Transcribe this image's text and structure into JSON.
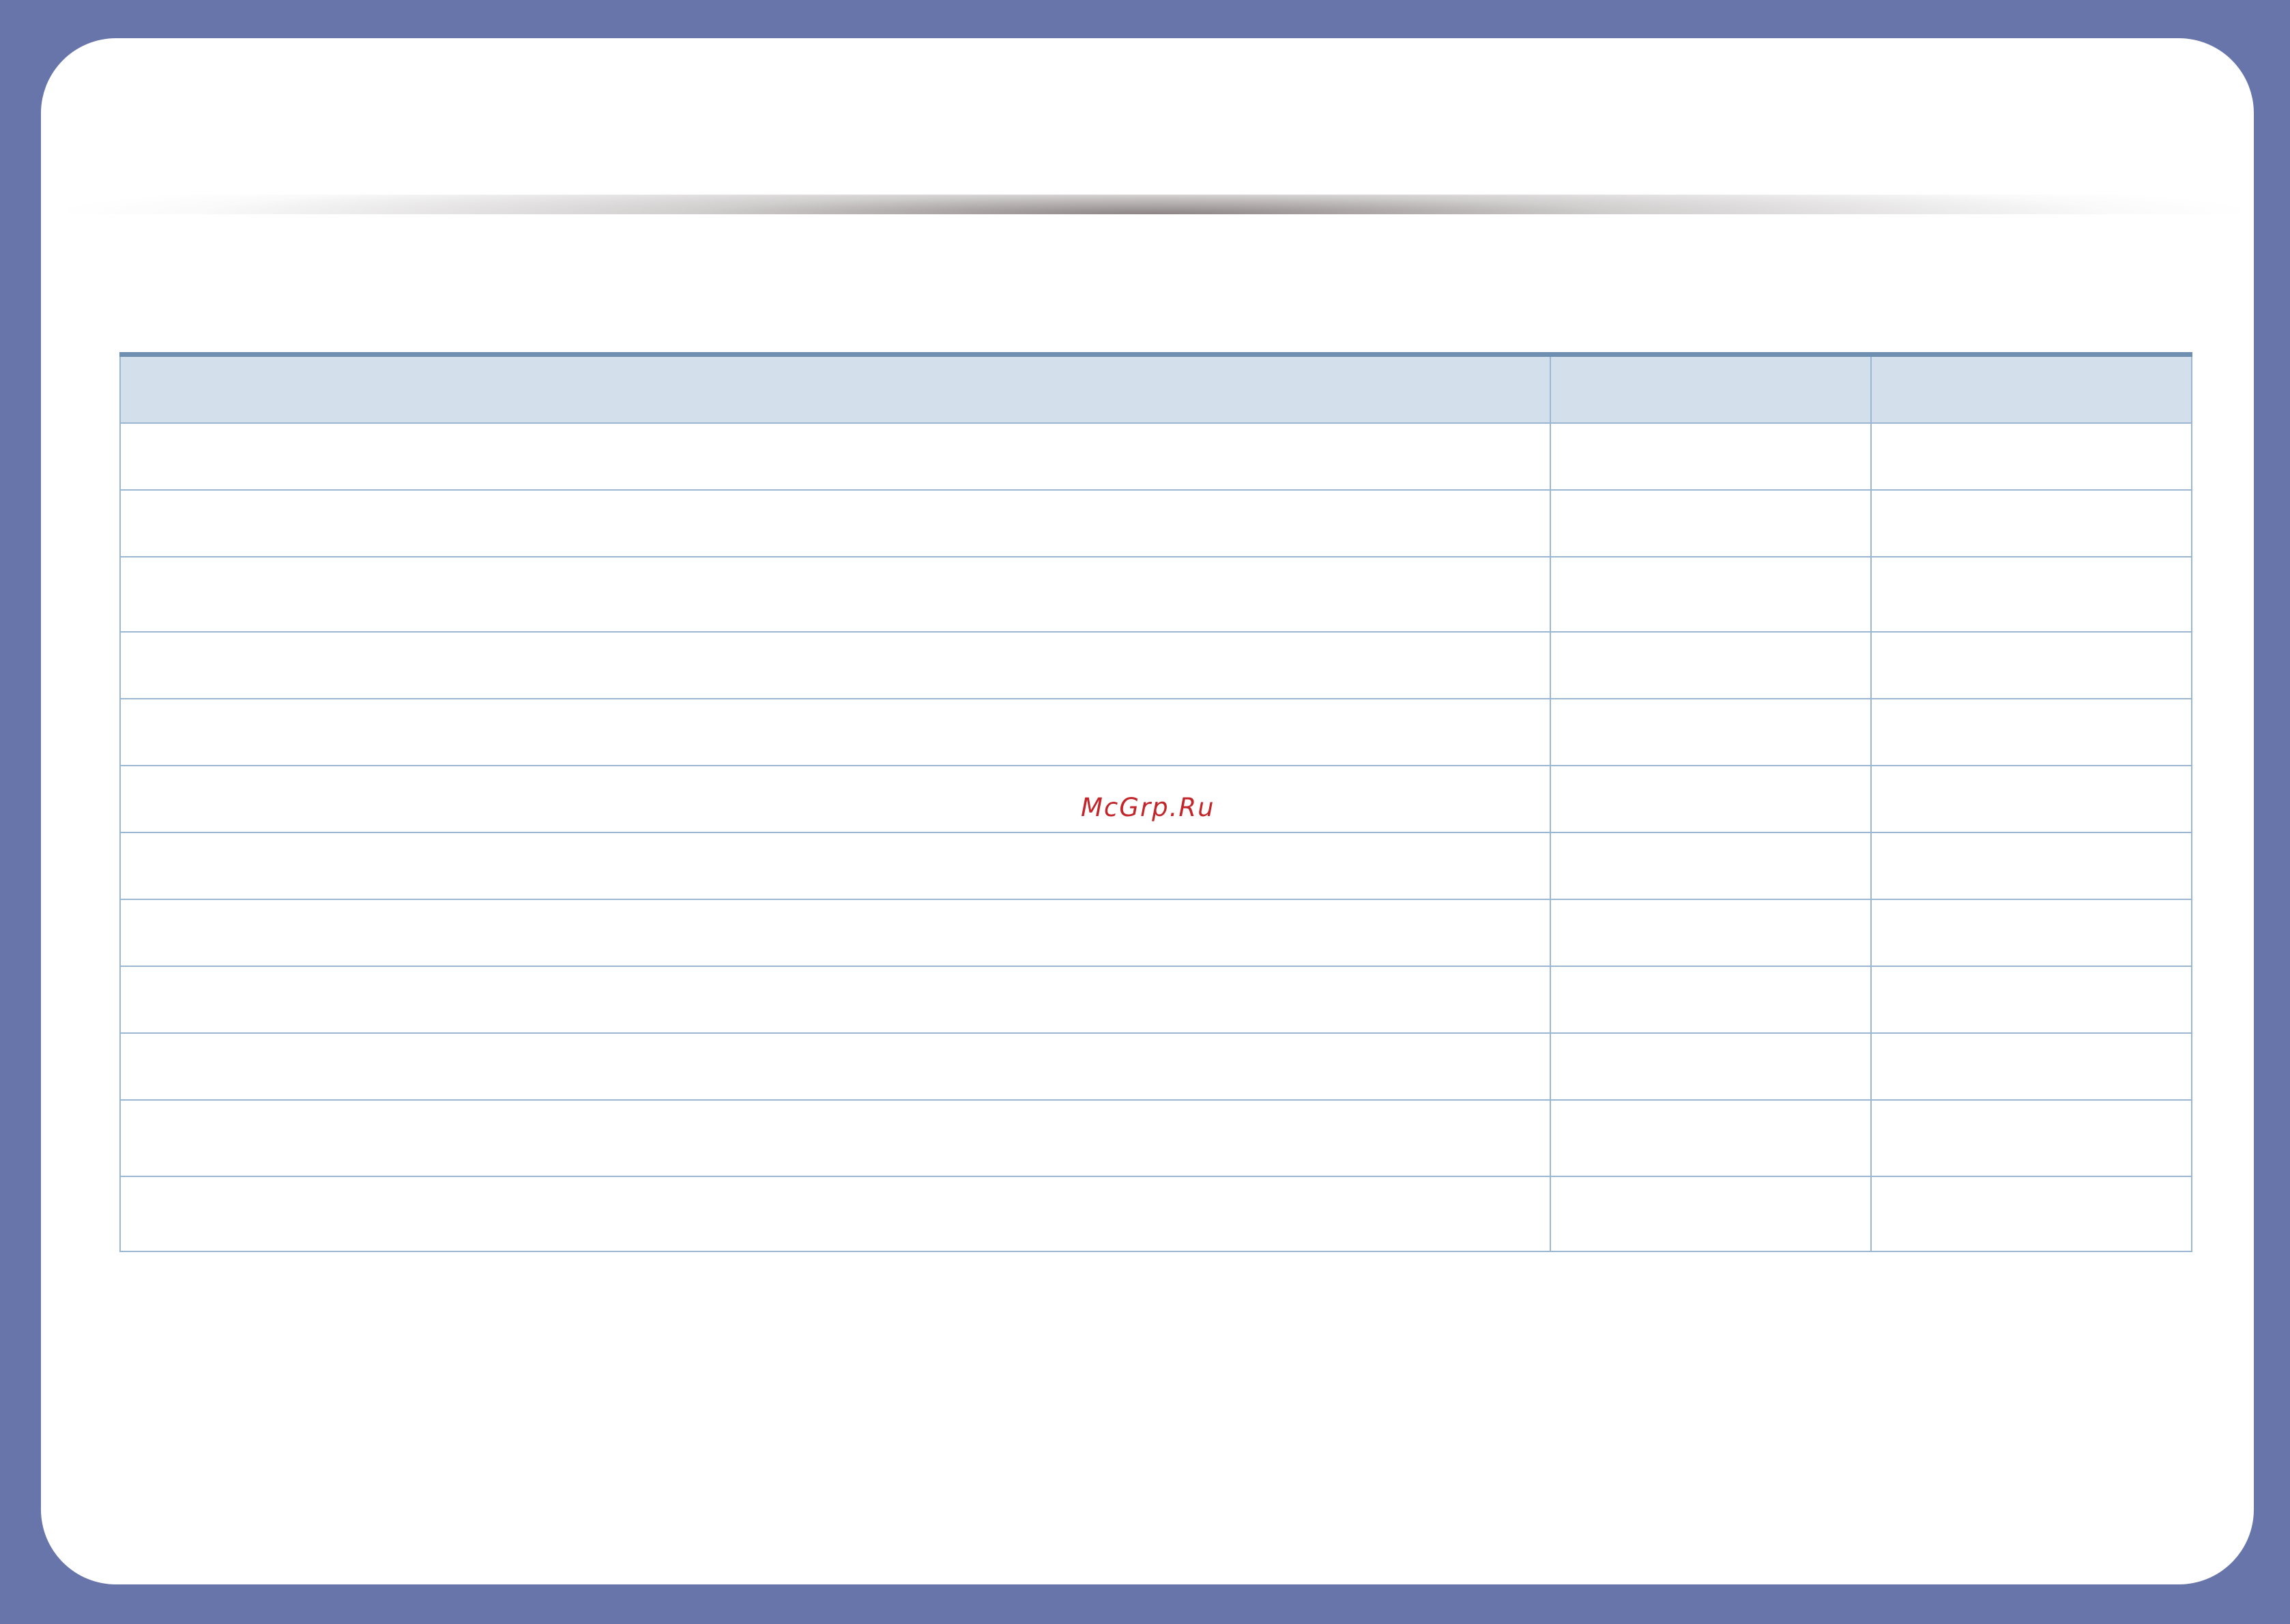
{
  "document": {
    "table": {
      "header": [
        "",
        "",
        ""
      ],
      "rows": [
        [
          "",
          "",
          ""
        ],
        [
          "",
          "",
          ""
        ],
        [
          "",
          "",
          ""
        ],
        [
          "",
          "",
          ""
        ],
        [
          "",
          "",
          ""
        ],
        [
          "",
          "",
          ""
        ],
        [
          "",
          "",
          ""
        ],
        [
          "",
          "",
          ""
        ],
        [
          "",
          "",
          ""
        ],
        [
          "",
          "",
          ""
        ],
        [
          "",
          "",
          ""
        ],
        [
          "",
          "",
          ""
        ]
      ]
    },
    "watermark": "McGrp.Ru"
  },
  "colors": {
    "frame": "#6775ab",
    "page": "#ffffff",
    "table_header_fill": "#d3dfea",
    "table_border": "#9ab6d2",
    "table_top_rule": "#6f8fb1",
    "watermark": "#c3262a"
  }
}
